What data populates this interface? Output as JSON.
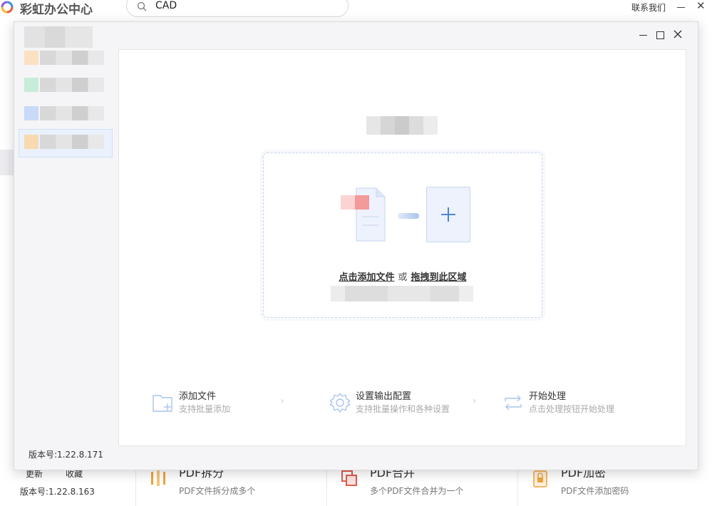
{
  "app": {
    "title": "彩虹办公中心",
    "search_value": "CAD",
    "contact_label": "联系我们",
    "close_glyph": "✕"
  },
  "background": {
    "update_label": "更新",
    "favorite_label": "收藏",
    "version": "版本号:1.22.8.163",
    "cards": [
      {
        "title": "PDF拆分",
        "desc": "PDF文件拆分成多个",
        "icon": "split-icon"
      },
      {
        "title": "PDF合并",
        "desc": "多个PDF文件合并为一个",
        "icon": "merge-icon"
      },
      {
        "title": "PDF加密",
        "desc": "PDF文件添加密码",
        "icon": "lock-icon"
      }
    ]
  },
  "modal": {
    "version": "版本号:1.22.8.171",
    "dropzone": {
      "click_add": "点击添加文件",
      "or": "或",
      "drag_here": "拖拽到此区域"
    },
    "steps": [
      {
        "title": "添加文件",
        "desc": "支持批量添加",
        "icon": "folder-add-icon"
      },
      {
        "title": "设置输出配置",
        "desc": "支持批量操作和各种设置",
        "icon": "gear-icon"
      },
      {
        "title": "开始处理",
        "desc": "点击处理按钮开始处理",
        "icon": "repeat-icon"
      }
    ],
    "separator_glyph": "›"
  },
  "colors": {
    "accent": "#3a78d8",
    "selected_bg": "#eaf1fc"
  }
}
